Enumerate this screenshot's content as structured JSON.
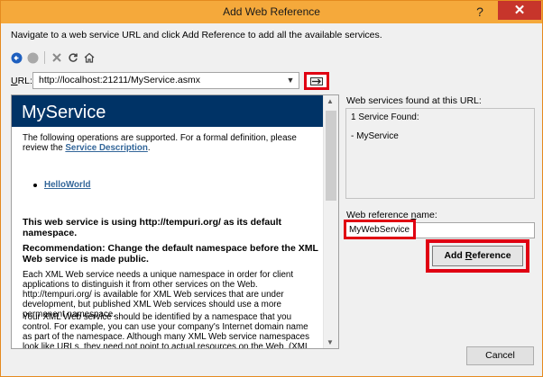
{
  "window": {
    "title": "Add Web Reference",
    "help": "?",
    "close": "✕"
  },
  "instruction": "Navigate to a web service URL and click Add Reference to add all the available services.",
  "toolbar": {
    "back": "back",
    "forward": "forward",
    "stop": "stop",
    "refresh": "refresh",
    "home": "home"
  },
  "url": {
    "label_prefix": "U",
    "label_rest": "RL:",
    "value": "http://localhost:21211/MyService.asmx",
    "arrow": "▼"
  },
  "browser": {
    "service_name": "MyService",
    "intro_a": "The following operations are supported. For a formal definition, please review the ",
    "intro_link": "Service Description",
    "intro_b": ".",
    "operations": [
      "HelloWorld"
    ],
    "warn_heading": "This web service is using http://tempuri.org/ as its default namespace.",
    "recommendation": "Recommendation: Change the default namespace before the XML Web service is made public.",
    "para1": "Each XML Web service needs a unique namespace in order for client applications to distinguish it from other services on the Web. http://tempuri.org/ is available for XML Web services that are under development, but published XML Web services should use a more permanent namespace.",
    "para2": "Your XML Web service should be identified by a namespace that you control. For example, you can use your company's Internet domain name as part of the namespace. Although many XML Web service namespaces look like URLs, they need not point to actual resources on the Web. (XML Web service namespaces are URIs.)"
  },
  "found": {
    "label": "Web services found at this URL:",
    "count": "1 Service Found:",
    "item": "- MyService"
  },
  "reference": {
    "label_a": "Web reference ",
    "label_u": "n",
    "label_b": "ame:",
    "value": "MyWebService"
  },
  "buttons": {
    "add_a": "Add ",
    "add_u": "R",
    "add_b": "eference",
    "cancel": "Cancel"
  },
  "colors": {
    "titlebar": "#f5a93b",
    "close": "#c7352b",
    "highlight": "#e00012",
    "service_header": "#003366",
    "link": "#336699"
  }
}
